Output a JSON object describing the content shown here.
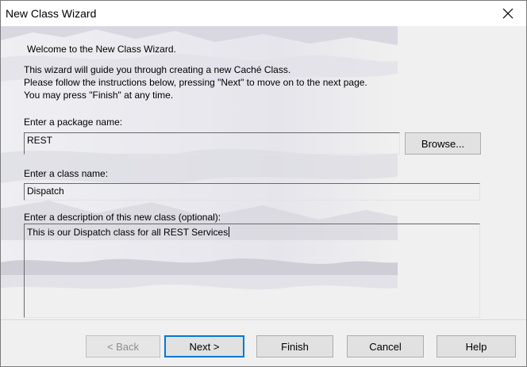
{
  "window": {
    "title": "New Class Wizard",
    "close_icon": "close-icon"
  },
  "intro": {
    "welcome": "Welcome to the New Class Wizard.",
    "line1": "This wizard will guide you through creating a new  Caché  Class.",
    "line2": "Please follow the instructions below, pressing \"Next\" to move on to the next page.",
    "line3": "You may press \"Finish\" at any time."
  },
  "package": {
    "label": "Enter a package name:",
    "value": "REST",
    "browse_label": "Browse..."
  },
  "classname": {
    "label": "Enter a class name:",
    "value": "Dispatch"
  },
  "description": {
    "label": "Enter a description of this new class (optional):",
    "value": "This is our Dispatch class for all REST Services"
  },
  "buttons": {
    "back": "< Back",
    "next": "Next >",
    "finish": "Finish",
    "cancel": "Cancel",
    "help": "Help"
  },
  "colors": {
    "accent": "#0078d7",
    "background": "#f0f0f0"
  }
}
